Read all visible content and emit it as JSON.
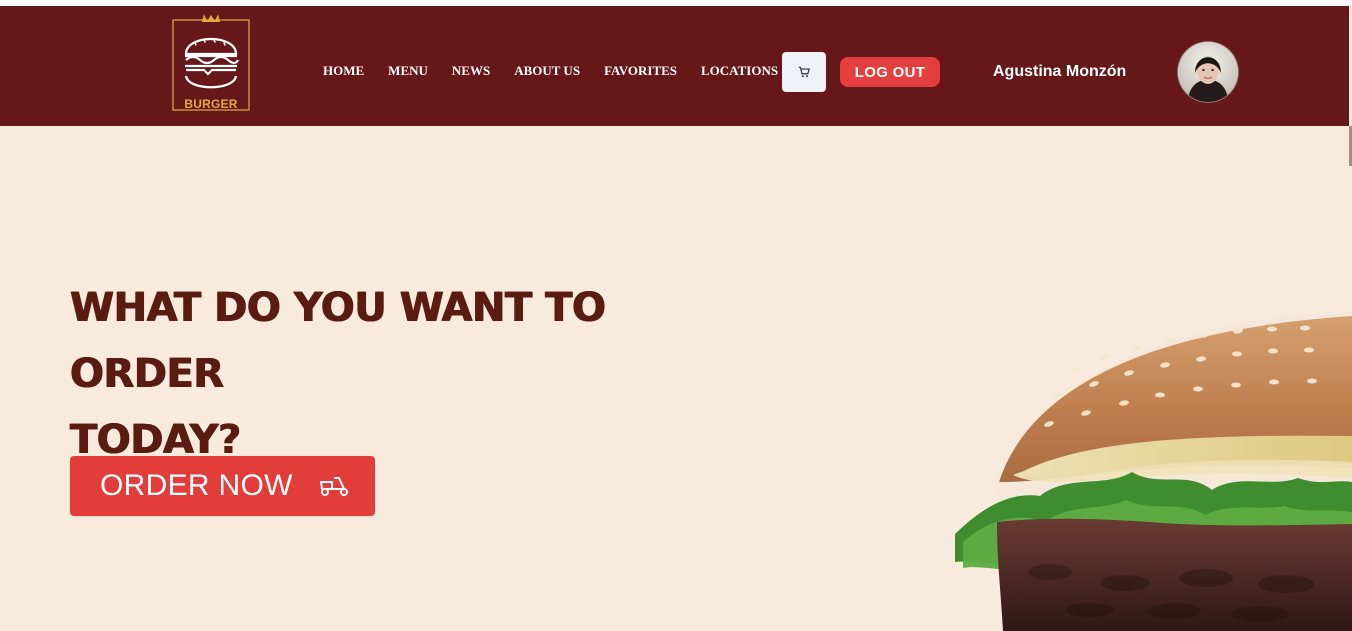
{
  "brand": {
    "logo_text": "BURGER",
    "logo_icon": "burger-crown-icon"
  },
  "nav": {
    "items": [
      {
        "label": "HOME"
      },
      {
        "label": "MENU"
      },
      {
        "label": "NEWS"
      },
      {
        "label": "ABOUT US"
      },
      {
        "label": "FAVORITES"
      },
      {
        "label": "LOCATIONS"
      }
    ]
  },
  "header": {
    "cart_icon": "cart-icon",
    "logout_label": "LOG OUT",
    "username": "Agustina Monzón",
    "avatar_icon": "user-avatar"
  },
  "hero": {
    "title_line1": "WHAT DO YOU WANT TO ORDER",
    "title_line2": "TODAY?",
    "cta_label": "ORDER NOW",
    "cta_icon": "scooter-icon",
    "image_icon": "burger-photo"
  },
  "colors": {
    "header_bg": "#66171a",
    "page_bg": "#f8ebdd",
    "accent_red": "#e53e3e",
    "headline": "#5a1b12",
    "logo_gold": "#e9a83e"
  }
}
